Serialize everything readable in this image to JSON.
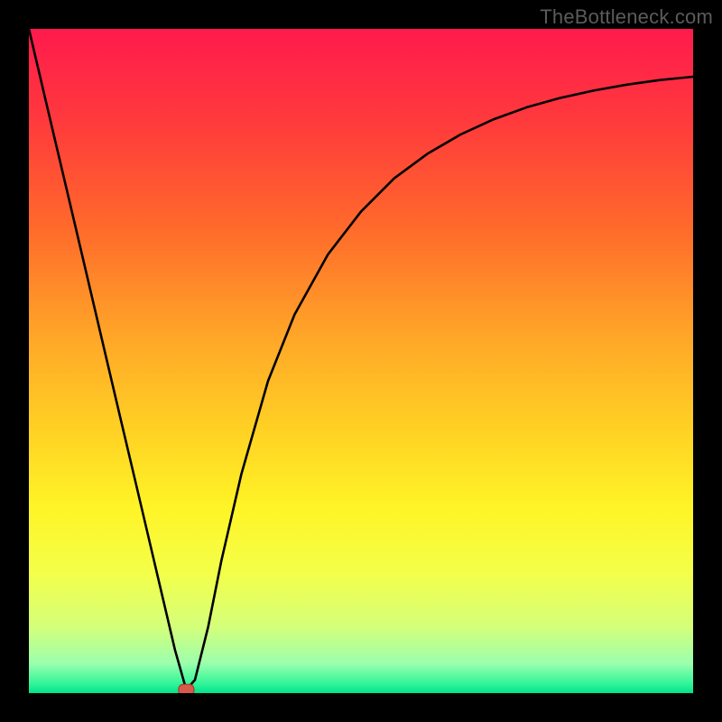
{
  "attribution": "TheBottleneck.com",
  "colors": {
    "frame": "#000000",
    "gradient_stops": [
      {
        "offset": 0.0,
        "color": "#ff1a4d"
      },
      {
        "offset": 0.14,
        "color": "#ff3a3c"
      },
      {
        "offset": 0.3,
        "color": "#ff6a2b"
      },
      {
        "offset": 0.46,
        "color": "#ffa528"
      },
      {
        "offset": 0.6,
        "color": "#ffd024"
      },
      {
        "offset": 0.72,
        "color": "#fff426"
      },
      {
        "offset": 0.82,
        "color": "#f3ff4a"
      },
      {
        "offset": 0.9,
        "color": "#d4ff7a"
      },
      {
        "offset": 0.955,
        "color": "#9cffad"
      },
      {
        "offset": 0.985,
        "color": "#35f59a"
      },
      {
        "offset": 1.0,
        "color": "#00e28a"
      }
    ],
    "curve": "#000000",
    "marker_fill": "#d85a4a",
    "marker_stroke": "#a63c2e"
  },
  "chart_data": {
    "type": "line",
    "title": "",
    "xlabel": "",
    "ylabel": "",
    "xlim": [
      0,
      100
    ],
    "ylim": [
      0,
      100
    ],
    "grid": false,
    "legend": false,
    "series": [
      {
        "name": "bottleneck-curve",
        "x": [
          0,
          2,
          4,
          6,
          8,
          10,
          12,
          14,
          16,
          18,
          20,
          22,
          23.7,
          25,
          27,
          29,
          32,
          36,
          40,
          45,
          50,
          55,
          60,
          65,
          70,
          75,
          80,
          85,
          90,
          95,
          100
        ],
        "y": [
          100,
          91.5,
          83,
          74.5,
          66,
          57.5,
          49,
          40.5,
          32,
          23.5,
          15,
          6.5,
          0.5,
          2,
          10,
          20,
          33,
          47,
          57,
          66,
          72.5,
          77.5,
          81.2,
          84.1,
          86.4,
          88.2,
          89.6,
          90.7,
          91.6,
          92.3,
          92.8
        ]
      }
    ],
    "marker": {
      "x": 23.7,
      "y": 0.5
    },
    "notes": "Inferred V-shaped bottleneck curve. No axis ticks or labels are shown in the image; values are an approximate digitization of the black curve against a 0-100 normalized coordinate system."
  }
}
